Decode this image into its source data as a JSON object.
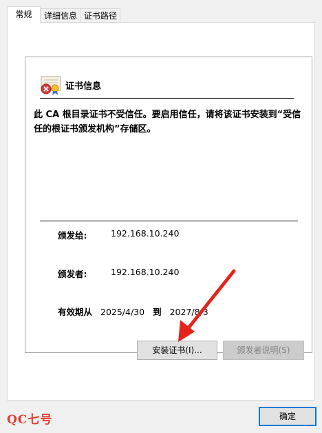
{
  "tabs": [
    {
      "label": "常规"
    },
    {
      "label": "详细信息"
    },
    {
      "label": "证书路径"
    }
  ],
  "cert": {
    "title": "证书信息",
    "warning": "此 CA 根目录证书不受信任。要启用信任，请将该证书安装到“受信任的根证书颁发机构”存储区。",
    "issued_to_label": "颁发给:",
    "issued_to_value": "192.168.10.240",
    "issued_by_label": "颁发者:",
    "issued_by_value": "192.168.10.240",
    "valid_from_label": "有效期从",
    "valid_from": "2025/4/30",
    "valid_to_label": "到",
    "valid_to": "2027/8/3"
  },
  "buttons": {
    "install": "安装证书(I)...",
    "issuer_statement": "颁发者说明(S)",
    "ok": "确定"
  },
  "watermark": "QC七号",
  "colors": {
    "arrow": "#e4231b",
    "ok_border": "#0078d7"
  }
}
